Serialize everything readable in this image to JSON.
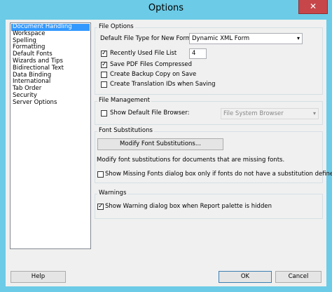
{
  "window": {
    "title": "Options",
    "close_glyph": "✕"
  },
  "categories": [
    "Document Handling",
    "Workspace",
    "Spelling",
    "Formatting",
    "Default Fonts",
    "Wizards and Tips",
    "Bidirectional Text",
    "Data Binding",
    "International",
    "Tab Order",
    "Security",
    "Server Options"
  ],
  "selected_category": "Document Handling",
  "file_options": {
    "legend": "File Options",
    "default_type_label": "Default File Type for New Forms:",
    "default_type_value": "Dynamic XML Form",
    "recent_list_label": "Recently Used File List",
    "recent_list_checked": true,
    "recent_list_count": "4",
    "save_pdf_label": "Save PDF Files Compressed",
    "save_pdf_checked": true,
    "backup_label": "Create Backup Copy on Save",
    "backup_checked": false,
    "translation_label": "Create Translation IDs when Saving",
    "translation_checked": false
  },
  "file_management": {
    "legend": "File Management",
    "show_browser_label": "Show Default File Browser:",
    "show_browser_checked": false,
    "browser_value": "File System Browser"
  },
  "font_substitutions": {
    "legend": "Font Substitutions",
    "button_label": "Modify Font Substitutions...",
    "description": "Modify font substitutions for documents that are missing fonts.",
    "show_missing_label": "Show Missing Fonts dialog box only if fonts do not have a substitution defined",
    "show_missing_checked": false
  },
  "warnings": {
    "legend": "Warnings",
    "show_warning_label": "Show Warning dialog box when Report palette is hidden",
    "show_warning_checked": true
  },
  "buttons": {
    "help": "Help",
    "ok": "OK",
    "cancel": "Cancel"
  },
  "colors": {
    "title_bar": "#6ccbe6",
    "close_button": "#c7464a",
    "selection": "#3399ff"
  }
}
